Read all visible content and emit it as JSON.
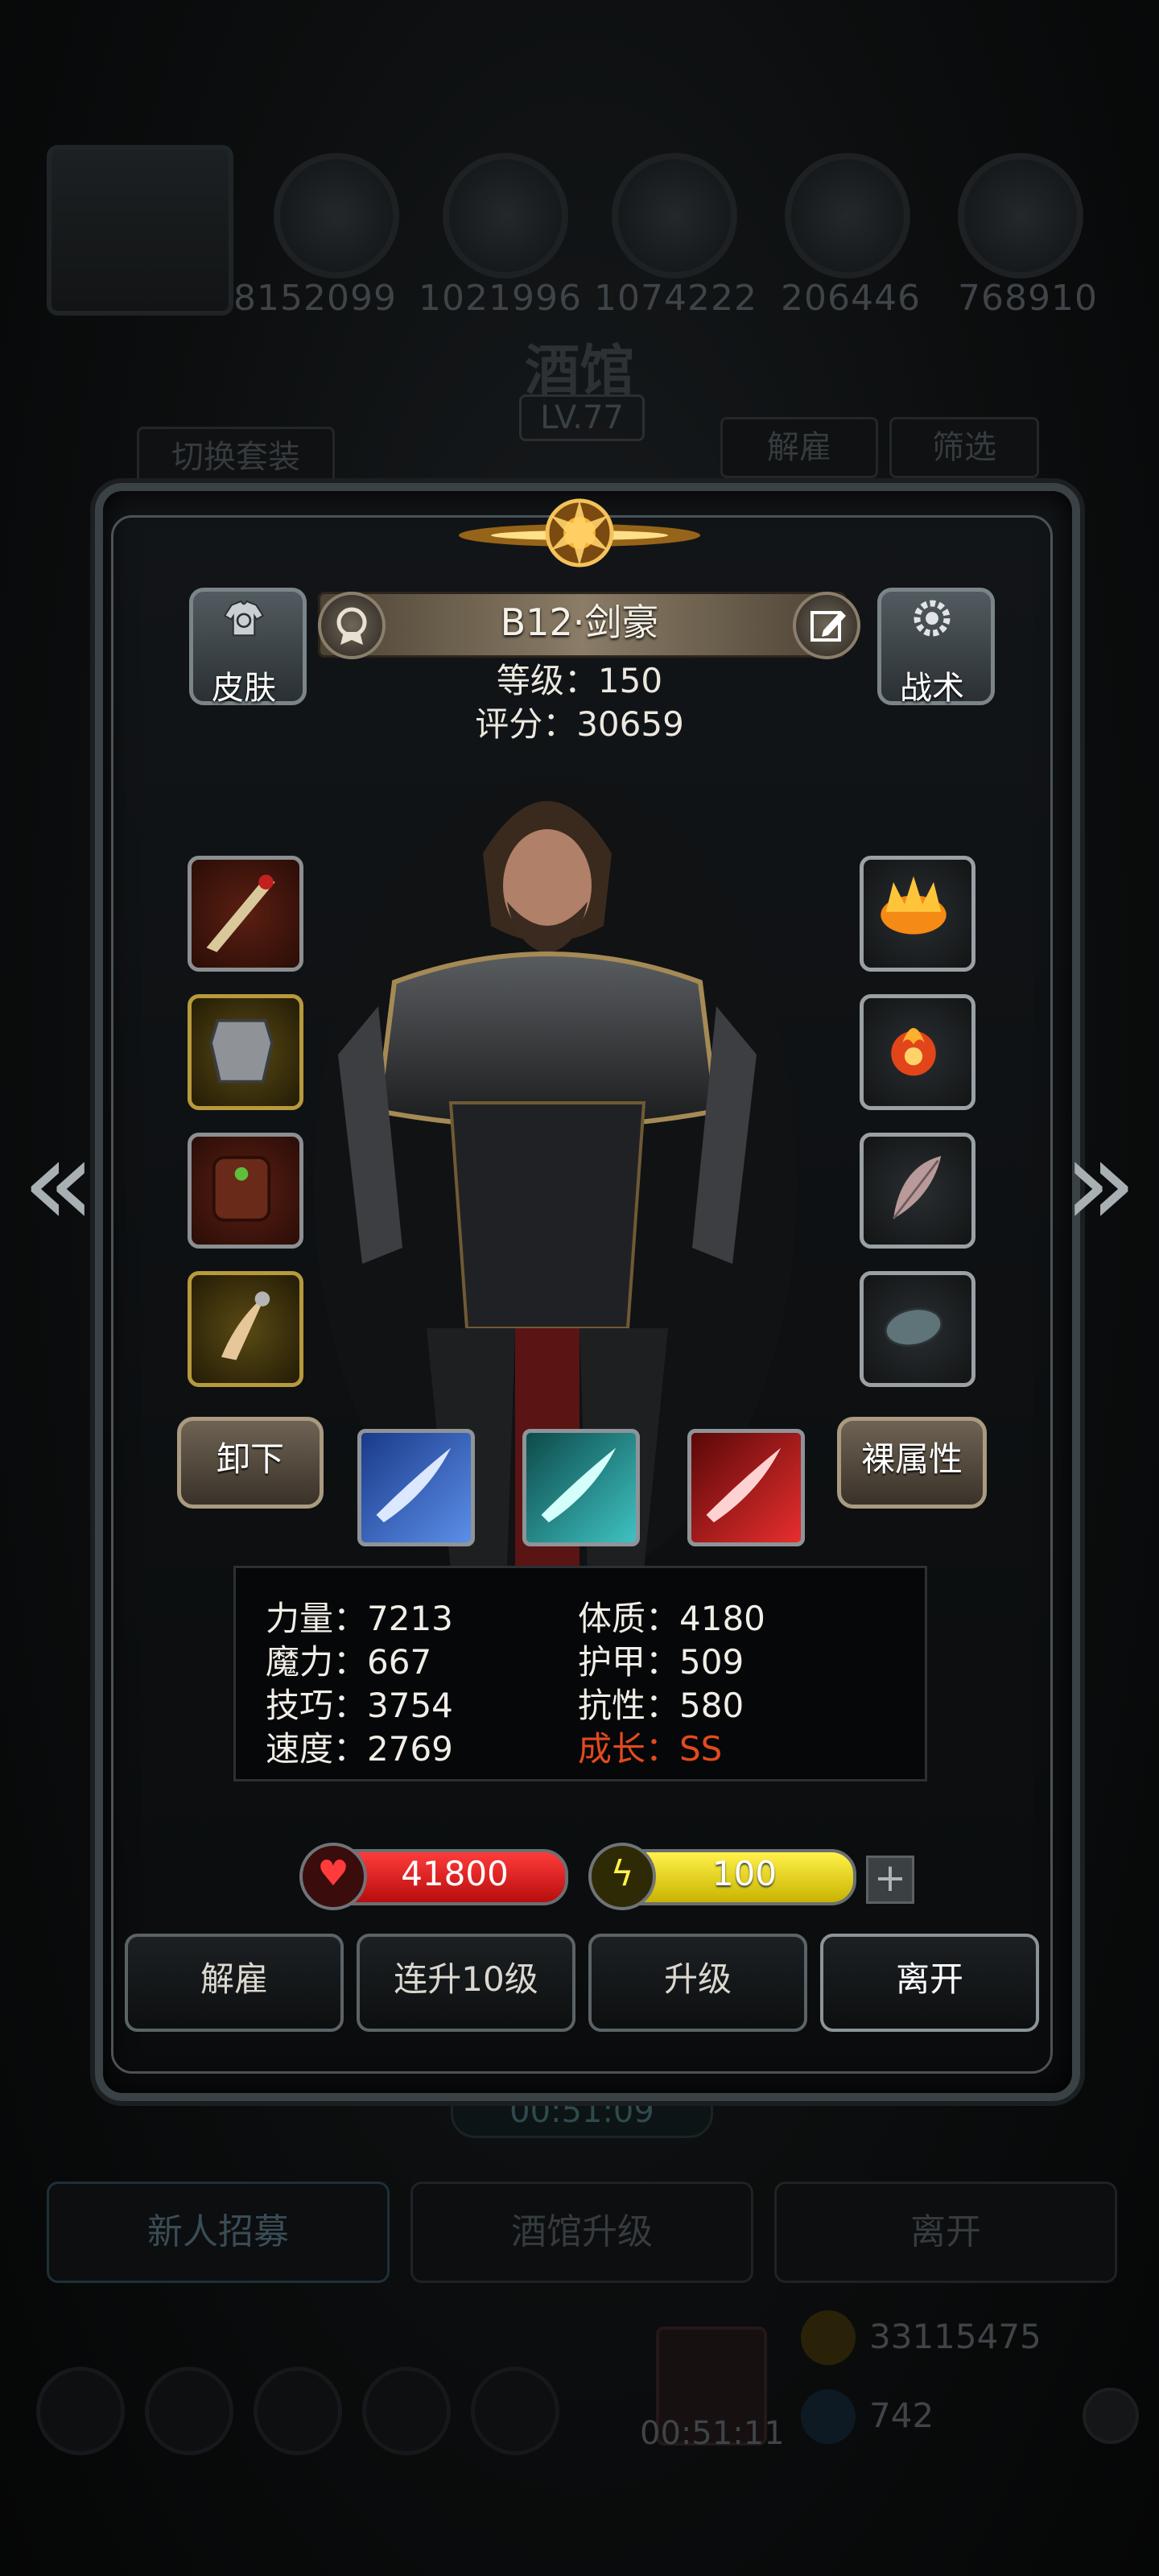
{
  "background": {
    "resource_numbers": [
      "8152099",
      "1021996",
      "1074222",
      "206446",
      "768910"
    ],
    "title": "酒馆",
    "level": "LV.77",
    "switch_outfit": "切换套装",
    "dismiss": "解雇",
    "filter": "筛选",
    "timer": "00:51:09",
    "tabs": [
      "新人招募",
      "酒馆升级",
      "离开"
    ],
    "bottom_timer": "00:51:11",
    "gold": "33115475",
    "gems": "742"
  },
  "hero": {
    "name": "B12·剑豪",
    "level_label": "等级：150",
    "score_label": "评分：30659"
  },
  "corner_buttons": {
    "skin": "皮肤",
    "tactics": "战术"
  },
  "equipment": {
    "left": [
      "sword-icon",
      "armor-icon",
      "backpack-icon",
      "claw-icon"
    ],
    "right": [
      "flame-crown-icon",
      "fire-orb-icon",
      "feather-icon",
      "stone-icon"
    ]
  },
  "action_pills": {
    "unequip": "卸下",
    "base_attributes": "裸属性"
  },
  "skills": [
    "blue-slash-icon",
    "cyan-slash-icon",
    "red-slash-icon"
  ],
  "stats": {
    "strength": "力量：7213",
    "constitution": "体质：4180",
    "magic": "魔力：667",
    "armor": "护甲：509",
    "skill": "技巧：3754",
    "resistance": "抗性：580",
    "speed": "速度：2769",
    "growth": "成长：SS"
  },
  "bars": {
    "hp": "41800",
    "energy": "100"
  },
  "buttons": {
    "dismiss": "解雇",
    "level_up_10": "连升10级",
    "level_up": "升级",
    "leave": "离开"
  },
  "colors": {
    "growth_text": "#e24a1f",
    "hp_bar": "#d61515",
    "energy_bar": "#e3d21a"
  }
}
